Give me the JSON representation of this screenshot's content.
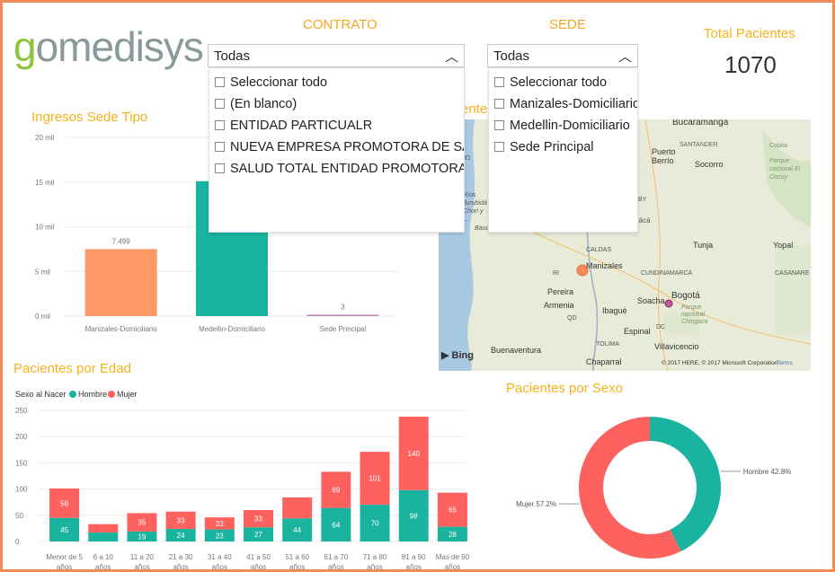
{
  "logo": {
    "prefix": "g",
    "rest": "omedisys"
  },
  "contrato": {
    "title": "CONTRATO",
    "selected": "Todas",
    "options": [
      "Seleccionar todo",
      "(En blanco)",
      "ENTIDAD PARTICUALR",
      "NUEVA EMPRESA PROMOTORA DE SALU...",
      "SALUD TOTAL ENTIDAD PROMOTORA D..."
    ]
  },
  "sede": {
    "title": "SEDE",
    "selected": "Todas",
    "options": [
      "Seleccionar todo",
      "Manizales-Domiciliario",
      "Medellin-Domiciliario",
      "Sede Principal"
    ]
  },
  "kpi": {
    "title": "Total Pacientes",
    "value": "1070"
  },
  "map": {
    "title_fragment": "entes",
    "labels": [
      "Bucaramanga",
      "Puerto Berrío",
      "SANTANDER",
      "Socorro",
      "Cobiia",
      "Parque nacional El Cocuy",
      "Tunja",
      "Yopal",
      "CASANARE",
      "CALDAS",
      "Manizales",
      "Pereira",
      "Armenia",
      "Ibagué",
      "CUNDINAMARCA",
      "Soacha",
      "Bogotá",
      "Parque nacional Chingaza",
      "Espinal",
      "TOLIMA",
      "Villavicencio",
      "Buenaventura",
      "Chaparral",
      "Ríos Jurubidá Chorí y ...",
      "Baudó",
      "HO",
      "QD",
      "RI",
      "DC",
      "BY",
      "rácá"
    ],
    "bing": "Bing",
    "copyright": "© 2017 HERE, © 2017 Microsoft Corporation",
    "terms": "Terms",
    "colors": {
      "water": "#a9c9e3",
      "land": "#e9ecd9",
      "marker": "#f28c5a",
      "marker2": "#c05a9a"
    }
  },
  "colors": {
    "orange": "#fd9966",
    "teal": "#1ab3a0",
    "pink": "#fd625e",
    "purple": "#b887ad",
    "title": "#f5b21b"
  },
  "chart_data": [
    {
      "type": "bar",
      "title": "Ingresos Sede Tipo",
      "categories": [
        "Manizales-Domiciliario",
        "Medellin-Domiciliario",
        "Sede Principal"
      ],
      "values": [
        7499,
        15100,
        3
      ],
      "data_labels": [
        "7.499",
        "",
        "3"
      ],
      "colors": [
        "#fd9966",
        "#1ab3a0",
        "#b887ad"
      ],
      "yticks": [
        "0 mil",
        "5 mil",
        "10 mil",
        "15 mil",
        "20 mil"
      ],
      "ylim": [
        0,
        20000
      ]
    },
    {
      "type": "bar",
      "title": "Pacientes por Edad",
      "legend_title": "Sexo al Nacer",
      "stacked": true,
      "categories": [
        "Menor de 5 años",
        "6 a 10 años",
        "11 a 20 años",
        "21 a 30 años",
        "31 a 40 años",
        "41 a 50 años",
        "51 a 60 años",
        "61 a 70 años",
        "71 a 80 años",
        "81 a 90 años",
        "Mas de 90 años"
      ],
      "series": [
        {
          "name": "Hombre",
          "values": [
            45,
            17,
            19,
            24,
            23,
            27,
            44,
            64,
            70,
            98,
            28
          ]
        },
        {
          "name": "Mujer",
          "values": [
            56,
            16,
            35,
            33,
            23,
            33,
            40,
            69,
            101,
            140,
            65
          ]
        }
      ],
      "data_labels": {
        "Hombre": [
          "45",
          "",
          "19",
          "24",
          "23",
          "27",
          "44",
          "64",
          "70",
          "98",
          "28"
        ],
        "Mujer": [
          "56",
          "",
          "35",
          "33",
          "23",
          "33",
          "",
          "69",
          "101",
          "140",
          "65"
        ]
      },
      "yticks": [
        "0",
        "50",
        "100",
        "150",
        "200",
        "250"
      ],
      "ylim": [
        0,
        250
      ]
    },
    {
      "type": "pie",
      "title": "Pacientes por Sexo",
      "labels": [
        "Hombre",
        "Mujer"
      ],
      "values": [
        42.8,
        57.2
      ],
      "data_labels": [
        "Hombre 42.8%",
        "Mujer 57.2%"
      ],
      "donut": true
    }
  ]
}
